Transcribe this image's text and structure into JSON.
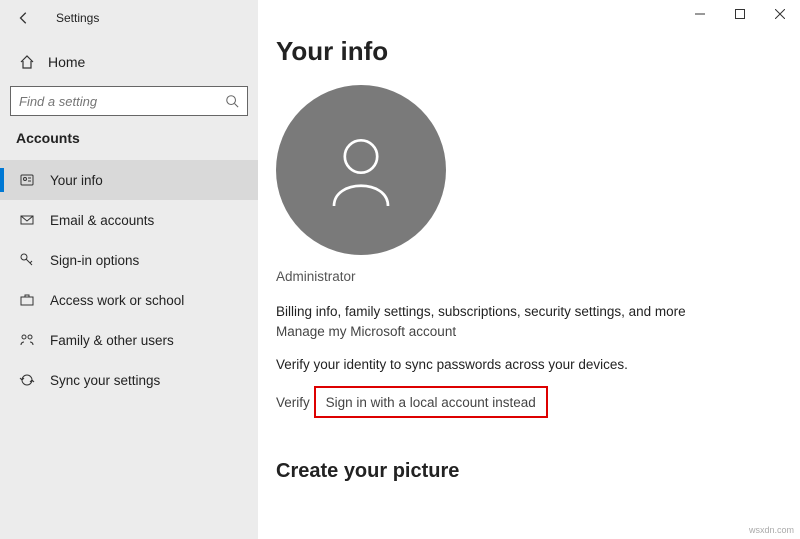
{
  "header": {
    "app_title": "Settings",
    "home_label": "Home",
    "search_placeholder": "Find a setting"
  },
  "sidebar": {
    "section_title": "Accounts",
    "items": [
      {
        "label": "Your info",
        "icon": "your-info-icon",
        "active": true
      },
      {
        "label": "Email & accounts",
        "icon": "email-icon",
        "active": false
      },
      {
        "label": "Sign-in options",
        "icon": "key-icon",
        "active": false
      },
      {
        "label": "Access work or school",
        "icon": "briefcase-icon",
        "active": false
      },
      {
        "label": "Family & other users",
        "icon": "family-icon",
        "active": false
      },
      {
        "label": "Sync your settings",
        "icon": "sync-icon",
        "active": false
      }
    ]
  },
  "main": {
    "title": "Your info",
    "role": "Administrator",
    "billing_desc": "Billing info, family settings, subscriptions, security settings, and more",
    "manage_link": "Manage my Microsoft account",
    "verify_desc": "Verify your identity to sync passwords across your devices.",
    "verify_link": "Verify",
    "local_account_link": "Sign in with a local account instead",
    "create_picture_title": "Create your picture"
  },
  "watermark": "wsxdn.com"
}
